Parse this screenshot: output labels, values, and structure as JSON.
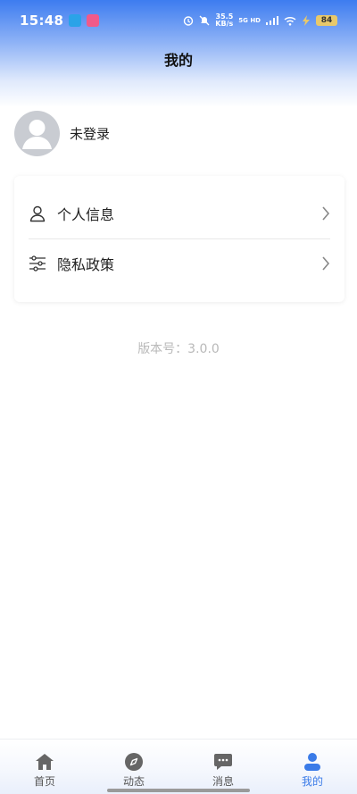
{
  "status_bar": {
    "time": "15:48",
    "net_speed_value": "35.5",
    "net_speed_unit": "KB/s",
    "network": "5G HD",
    "battery": "84"
  },
  "header": {
    "title": "我的"
  },
  "profile": {
    "name": "未登录",
    "avatar_icon": "avatar-placeholder-icon"
  },
  "menu": {
    "items": [
      {
        "label": "个人信息",
        "icon": "user-icon"
      },
      {
        "label": "隐私政策",
        "icon": "sliders-icon"
      }
    ]
  },
  "version": {
    "text": "版本号：3.0.0"
  },
  "tabbar": {
    "active": "我的",
    "accent": "#3a7be8",
    "tabs": [
      {
        "label": "首页",
        "icon": "home-icon"
      },
      {
        "label": "动态",
        "icon": "compass-icon"
      },
      {
        "label": "消息",
        "icon": "chat-icon"
      },
      {
        "label": "我的",
        "icon": "profile-icon"
      }
    ]
  }
}
